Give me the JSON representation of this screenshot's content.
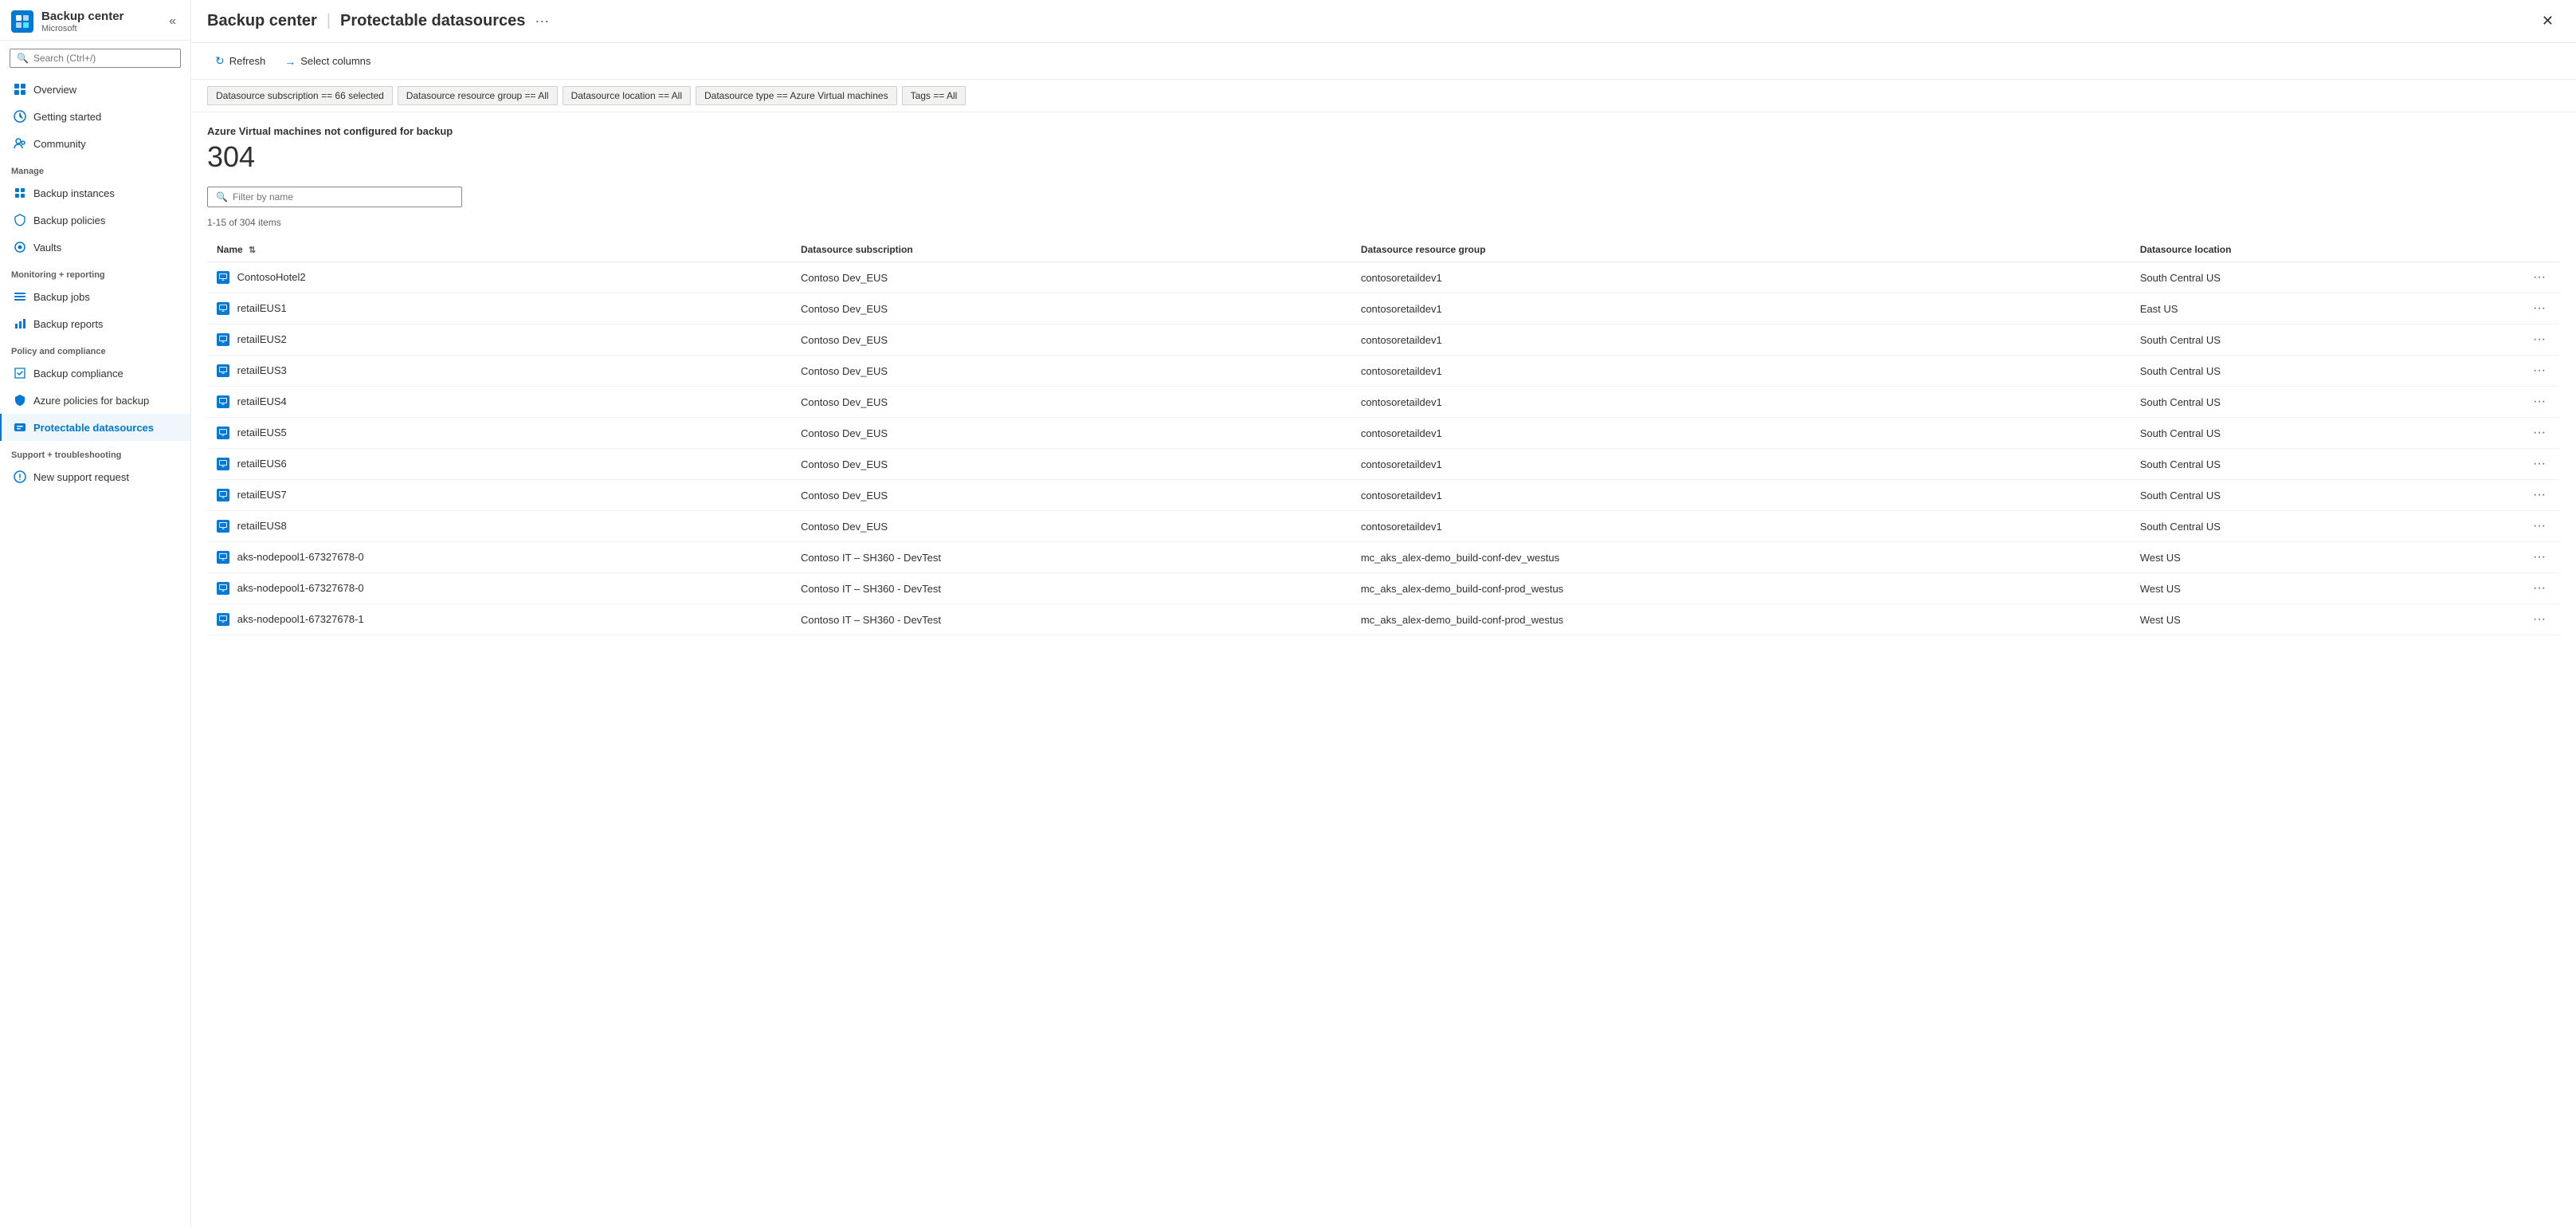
{
  "app": {
    "logo_text": "B",
    "title": "Backup center",
    "separator": "|",
    "subtitle": "Protectable datasources",
    "more_icon": "···",
    "microsoft_label": "Microsoft"
  },
  "search": {
    "placeholder": "Search (Ctrl+/)"
  },
  "sidebar": {
    "collapse_icon": "«",
    "nav_items": [
      {
        "id": "overview",
        "label": "Overview",
        "icon": "overview"
      },
      {
        "id": "getting-started",
        "label": "Getting started",
        "icon": "getting-started"
      },
      {
        "id": "community",
        "label": "Community",
        "icon": "community"
      }
    ],
    "manage_label": "Manage",
    "manage_items": [
      {
        "id": "backup-instances",
        "label": "Backup instances",
        "icon": "instances"
      },
      {
        "id": "backup-policies",
        "label": "Backup policies",
        "icon": "policies"
      },
      {
        "id": "vaults",
        "label": "Vaults",
        "icon": "vaults"
      }
    ],
    "monitoring_label": "Monitoring + reporting",
    "monitoring_items": [
      {
        "id": "backup-jobs",
        "label": "Backup jobs",
        "icon": "jobs"
      },
      {
        "id": "backup-reports",
        "label": "Backup reports",
        "icon": "reports"
      }
    ],
    "policy_label": "Policy and compliance",
    "policy_items": [
      {
        "id": "backup-compliance",
        "label": "Backup compliance",
        "icon": "compliance"
      },
      {
        "id": "azure-policies",
        "label": "Azure policies for backup",
        "icon": "azure-policies"
      },
      {
        "id": "protectable-datasources",
        "label": "Protectable datasources",
        "icon": "datasources",
        "active": true
      }
    ],
    "support_label": "Support + troubleshooting",
    "support_items": [
      {
        "id": "new-support-request",
        "label": "New support request",
        "icon": "support"
      }
    ]
  },
  "toolbar": {
    "refresh_label": "Refresh",
    "select_columns_label": "Select columns"
  },
  "filters": [
    {
      "id": "subscription",
      "label": "Datasource subscription == 66 selected"
    },
    {
      "id": "resource-group",
      "label": "Datasource resource group == All"
    },
    {
      "id": "location",
      "label": "Datasource location == All"
    },
    {
      "id": "type",
      "label": "Datasource type == Azure Virtual machines"
    },
    {
      "id": "tags",
      "label": "Tags == All"
    }
  ],
  "content": {
    "summary_title": "Azure Virtual machines not configured for backup",
    "summary_count": "304",
    "filter_placeholder": "Filter by name",
    "items_label": "1-15 of 304 items",
    "columns": [
      {
        "id": "name",
        "label": "Name",
        "sortable": true
      },
      {
        "id": "subscription",
        "label": "Datasource subscription",
        "sortable": false
      },
      {
        "id": "resource-group",
        "label": "Datasource resource group",
        "sortable": false
      },
      {
        "id": "location",
        "label": "Datasource location",
        "sortable": false
      }
    ],
    "rows": [
      {
        "name": "ContosoHotel2",
        "subscription": "Contoso Dev_EUS",
        "resource_group": "contosoretaildev1",
        "location": "South Central US"
      },
      {
        "name": "retailEUS1",
        "subscription": "Contoso Dev_EUS",
        "resource_group": "contosoretaildev1",
        "location": "East US"
      },
      {
        "name": "retailEUS2",
        "subscription": "Contoso Dev_EUS",
        "resource_group": "contosoretaildev1",
        "location": "South Central US"
      },
      {
        "name": "retailEUS3",
        "subscription": "Contoso Dev_EUS",
        "resource_group": "contosoretaildev1",
        "location": "South Central US"
      },
      {
        "name": "retailEUS4",
        "subscription": "Contoso Dev_EUS",
        "resource_group": "contosoretaildev1",
        "location": "South Central US"
      },
      {
        "name": "retailEUS5",
        "subscription": "Contoso Dev_EUS",
        "resource_group": "contosoretaildev1",
        "location": "South Central US"
      },
      {
        "name": "retailEUS6",
        "subscription": "Contoso Dev_EUS",
        "resource_group": "contosoretaildev1",
        "location": "South Central US"
      },
      {
        "name": "retailEUS7",
        "subscription": "Contoso Dev_EUS",
        "resource_group": "contosoretaildev1",
        "location": "South Central US"
      },
      {
        "name": "retailEUS8",
        "subscription": "Contoso Dev_EUS",
        "resource_group": "contosoretaildev1",
        "location": "South Central US"
      },
      {
        "name": "aks-nodepool1-67327678-0",
        "subscription": "Contoso IT – SH360 - DevTest",
        "resource_group": "mc_aks_alex-demo_build-conf-dev_westus",
        "location": "West US"
      },
      {
        "name": "aks-nodepool1-67327678-0",
        "subscription": "Contoso IT – SH360 - DevTest",
        "resource_group": "mc_aks_alex-demo_build-conf-prod_westus",
        "location": "West US"
      },
      {
        "name": "aks-nodepool1-67327678-1",
        "subscription": "Contoso IT – SH360 - DevTest",
        "resource_group": "mc_aks_alex-demo_build-conf-prod_westus",
        "location": "West US"
      }
    ],
    "more_icon": "···"
  },
  "close_icon": "✕"
}
